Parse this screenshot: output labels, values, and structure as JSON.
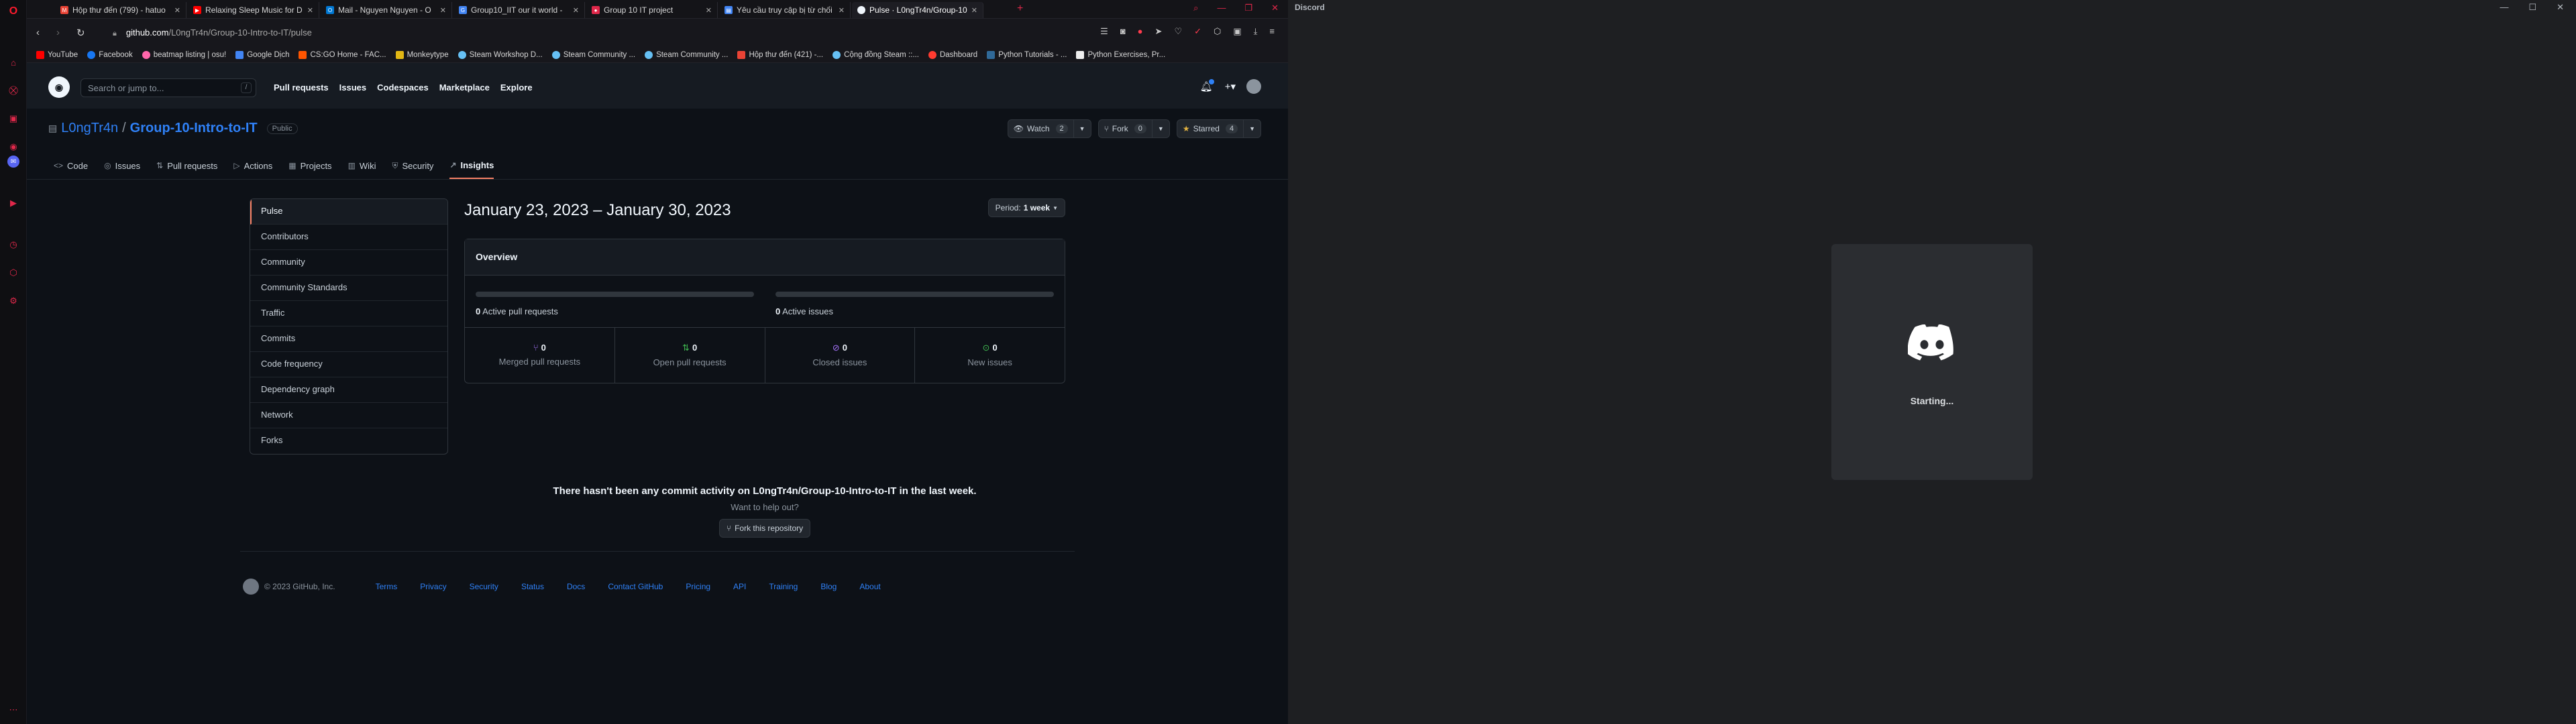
{
  "browser": {
    "tabs": [
      {
        "label": "Hộp thư đến (799) - hatuo",
        "fav_color": "#ea4335",
        "fav_glyph": "M"
      },
      {
        "label": "Relaxing Sleep Music for D",
        "fav_color": "#ff0000",
        "fav_glyph": "▶"
      },
      {
        "label": "Mail - Nguyen Nguyen - O",
        "fav_color": "#0078d4",
        "fav_glyph": "O"
      },
      {
        "label": "Group10_IIT our it world -",
        "fav_color": "#4285f4",
        "fav_glyph": "G"
      },
      {
        "label": "Group 10 IT project",
        "fav_color": "#e0284a",
        "fav_glyph": "●"
      },
      {
        "label": "Yêu cầu truy cập bị từ chối",
        "fav_color": "#4285f4",
        "fav_glyph": "▤"
      },
      {
        "label": "Pulse · L0ngTr4n/Group-10-",
        "fav_color": "#f0f6fc",
        "fav_glyph": "●"
      }
    ],
    "url_host": "github.com",
    "url_path": "/L0ngTr4n/Group-10-Intro-to-IT/pulse",
    "bookmarks": [
      {
        "label": "YouTube",
        "color": "#ff0000"
      },
      {
        "label": "Facebook",
        "color": "#1877f2"
      },
      {
        "label": "beatmap listing | osu!",
        "color": "#ff66aa"
      },
      {
        "label": "Google Dịch",
        "color": "#4285f4"
      },
      {
        "label": "CS:GO Home - FAC...",
        "color": "#ff5500"
      },
      {
        "label": "Monkeytype",
        "color": "#e2b714"
      },
      {
        "label": "Steam Workshop D...",
        "color": "#1b2838"
      },
      {
        "label": "Steam Community ...",
        "color": "#1b2838"
      },
      {
        "label": "Steam Community ...",
        "color": "#1b2838"
      },
      {
        "label": "Hộp thư đến (421) -...",
        "color": "#ea4335"
      },
      {
        "label": "Cộng đồng Steam ::...",
        "color": "#1b2838"
      },
      {
        "label": "Dashboard",
        "color": "#ff3b30"
      },
      {
        "label": "Python Tutorials - ...",
        "color": "#306998"
      },
      {
        "label": "Python Exercises, Pr...",
        "color": "#eeeeee"
      }
    ]
  },
  "github": {
    "search_placeholder": "Search or jump to...",
    "search_key": "/",
    "nav": [
      "Pull requests",
      "Issues",
      "Codespaces",
      "Marketplace",
      "Explore"
    ],
    "owner": "L0ngTr4n",
    "separator": "/",
    "repo": "Group-10-Intro-to-IT",
    "visibility": "Public",
    "watch_label": "Watch",
    "watch_count": "2",
    "fork_label": "Fork",
    "fork_count": "0",
    "star_label": "Starred",
    "star_count": "4",
    "tabs": [
      {
        "label": "Code",
        "icon": "<>"
      },
      {
        "label": "Issues",
        "icon": "◎"
      },
      {
        "label": "Pull requests",
        "icon": "⇅"
      },
      {
        "label": "Actions",
        "icon": "▷"
      },
      {
        "label": "Projects",
        "icon": "▦"
      },
      {
        "label": "Wiki",
        "icon": "▥"
      },
      {
        "label": "Security",
        "icon": "⛨"
      },
      {
        "label": "Insights",
        "icon": "↗"
      }
    ],
    "sidebar": [
      "Pulse",
      "Contributors",
      "Community",
      "Community Standards",
      "Traffic",
      "Commits",
      "Code frequency",
      "Dependency graph",
      "Network",
      "Forks"
    ],
    "date_range": "January 23, 2023 – January 30, 2023",
    "period_label": "Period:",
    "period_value": "1 week",
    "overview_title": "Overview",
    "active_prs_count": "0",
    "active_prs_label": "Active pull requests",
    "active_issues_count": "0",
    "active_issues_label": "Active issues",
    "stats": [
      {
        "count": "0",
        "label": "Merged pull requests",
        "icon": "⑂",
        "color": "#a371f7"
      },
      {
        "count": "0",
        "label": "Open pull requests",
        "icon": "⇅",
        "color": "#3fb950"
      },
      {
        "count": "0",
        "label": "Closed issues",
        "icon": "⊘",
        "color": "#a371f7"
      },
      {
        "count": "0",
        "label": "New issues",
        "icon": "⊙",
        "color": "#3fb950"
      }
    ],
    "no_activity": "There hasn't been any commit activity on L0ngTr4n/Group-10-Intro-to-IT in the last week.",
    "help_text": "Want to help out?",
    "fork_button": "Fork this repository",
    "footer_copy": "© 2023 GitHub, Inc.",
    "footer_links": [
      "Terms",
      "Privacy",
      "Security",
      "Status",
      "Docs",
      "Contact GitHub",
      "Pricing",
      "API",
      "Training",
      "Blog",
      "About"
    ]
  },
  "discord": {
    "title": "Discord",
    "status": "Starting..."
  }
}
